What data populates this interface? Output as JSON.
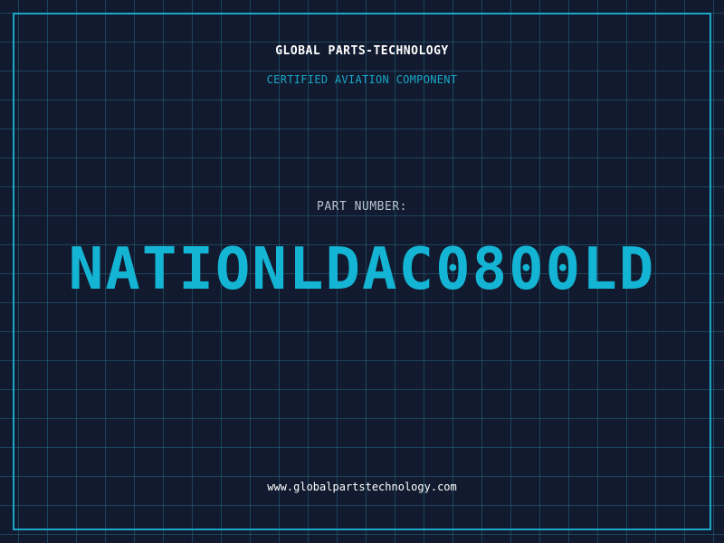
{
  "header": {
    "company": "GLOBAL PARTS-TECHNOLOGY",
    "tagline": "CERTIFIED AVIATION COMPONENT"
  },
  "part": {
    "label": "PART NUMBER:",
    "number": "NATIONLDAC0800LD"
  },
  "footer": {
    "website": "www.globalpartstechnology.com"
  },
  "colors": {
    "background": "#111a2e",
    "accent": "#1aa7c8",
    "part_number": "#14b4d4",
    "label": "#b9c4d4",
    "text": "#ffffff"
  }
}
